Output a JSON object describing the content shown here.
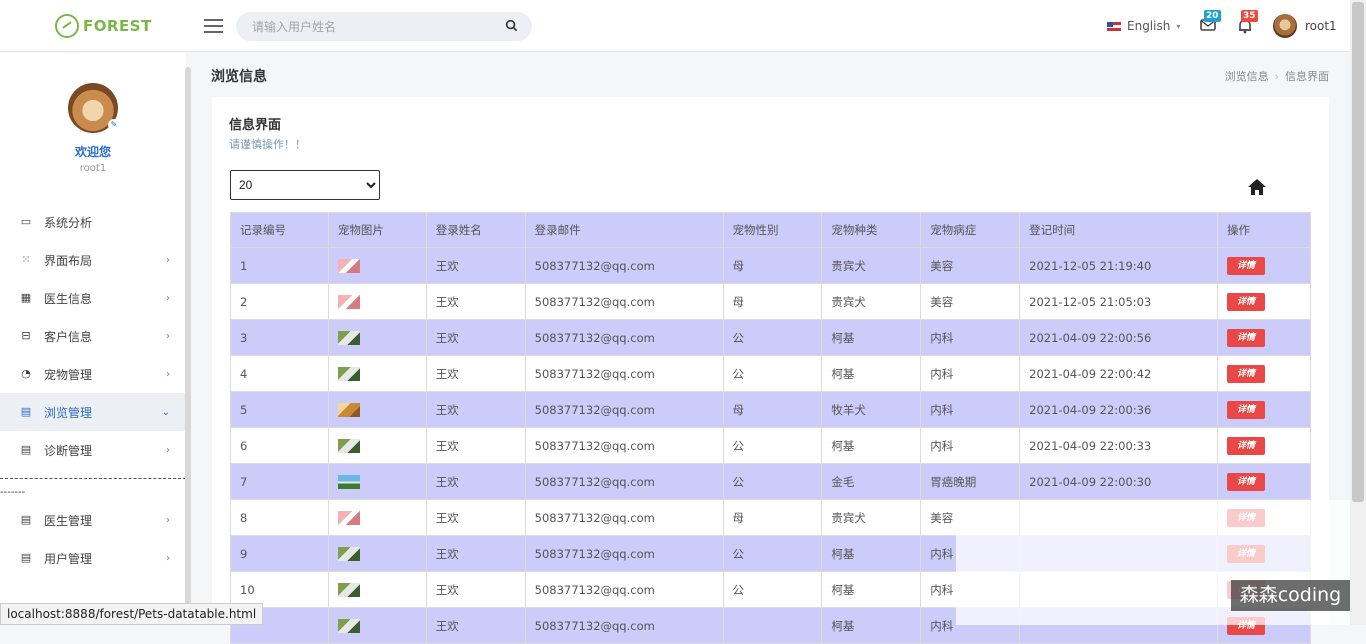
{
  "topbar": {
    "logo_text": "FOREST",
    "search_placeholder": "请输入用户姓名",
    "language": "English",
    "mail_count": "20",
    "notify_count": "35",
    "username": "root1"
  },
  "sidebar": {
    "welcome": "欢迎您",
    "username": "root1",
    "items": [
      {
        "label": "系统分析",
        "icon": "monitor-icon"
      },
      {
        "label": "界面布局",
        "icon": "grid-icon"
      },
      {
        "label": "医生信息",
        "icon": "calendar-icon"
      },
      {
        "label": "客户信息",
        "icon": "briefcase-icon"
      },
      {
        "label": "宠物管理",
        "icon": "paw-icon"
      },
      {
        "label": "浏览管理",
        "icon": "document-icon"
      },
      {
        "label": "诊断管理",
        "icon": "document-icon"
      }
    ],
    "items2": [
      {
        "label": "医生管理",
        "icon": "document-icon"
      },
      {
        "label": "用户管理",
        "icon": "document-icon"
      }
    ],
    "divider_text": "-------"
  },
  "page": {
    "title": "浏览信息",
    "breadcrumb": [
      "浏览信息",
      "信息界面"
    ]
  },
  "panel": {
    "title": "信息界面",
    "subtitle": "请谨慎操作！！",
    "page_size": "20"
  },
  "table": {
    "headers": [
      "记录编号",
      "宠物图片",
      "登录姓名",
      "登录邮件",
      "宠物性别",
      "宠物种类",
      "宠物病症",
      "登记时间",
      "操作"
    ],
    "detail_label": "详情",
    "rows": [
      {
        "id": "1",
        "img": "pink",
        "name": "王欢",
        "email": "508377132@qq.com",
        "sex": "母",
        "kind": "贵宾犬",
        "disease": "美容",
        "time": "2021-12-05 21:19:40"
      },
      {
        "id": "2",
        "img": "pink",
        "name": "王欢",
        "email": "508377132@qq.com",
        "sex": "母",
        "kind": "贵宾犬",
        "disease": "美容",
        "time": "2021-12-05 21:05:03"
      },
      {
        "id": "3",
        "img": "green",
        "name": "王欢",
        "email": "508377132@qq.com",
        "sex": "公",
        "kind": "柯基",
        "disease": "内科",
        "time": "2021-04-09 22:00:56"
      },
      {
        "id": "4",
        "img": "green",
        "name": "王欢",
        "email": "508377132@qq.com",
        "sex": "公",
        "kind": "柯基",
        "disease": "内科",
        "time": "2021-04-09 22:00:42"
      },
      {
        "id": "5",
        "img": "tan",
        "name": "王欢",
        "email": "508377132@qq.com",
        "sex": "母",
        "kind": "牧羊犬",
        "disease": "内科",
        "time": "2021-04-09 22:00:36"
      },
      {
        "id": "6",
        "img": "green",
        "name": "王欢",
        "email": "508377132@qq.com",
        "sex": "公",
        "kind": "柯基",
        "disease": "内科",
        "time": "2021-04-09 22:00:33"
      },
      {
        "id": "7",
        "img": "sky",
        "name": "王欢",
        "email": "508377132@qq.com",
        "sex": "公",
        "kind": "金毛",
        "disease": "胃癌晚期",
        "time": "2021-04-09 22:00:30"
      },
      {
        "id": "8",
        "img": "pink",
        "name": "王欢",
        "email": "508377132@qq.com",
        "sex": "母",
        "kind": "贵宾犬",
        "disease": "美容",
        "time": ""
      },
      {
        "id": "9",
        "img": "green",
        "name": "王欢",
        "email": "508377132@qq.com",
        "sex": "公",
        "kind": "柯基",
        "disease": "内科",
        "time": ""
      },
      {
        "id": "10",
        "img": "green",
        "name": "王欢",
        "email": "508377132@qq.com",
        "sex": "公",
        "kind": "柯基",
        "disease": "内科",
        "time": ""
      },
      {
        "id": "",
        "img": "green",
        "name": "王欢",
        "email": "508377132@qq.com",
        "sex": "",
        "kind": "柯基",
        "disease": "内科",
        "time": ""
      }
    ]
  },
  "watermark": "森森coding",
  "statusbar": "localhost:8888/forest/Pets-datatable.html"
}
